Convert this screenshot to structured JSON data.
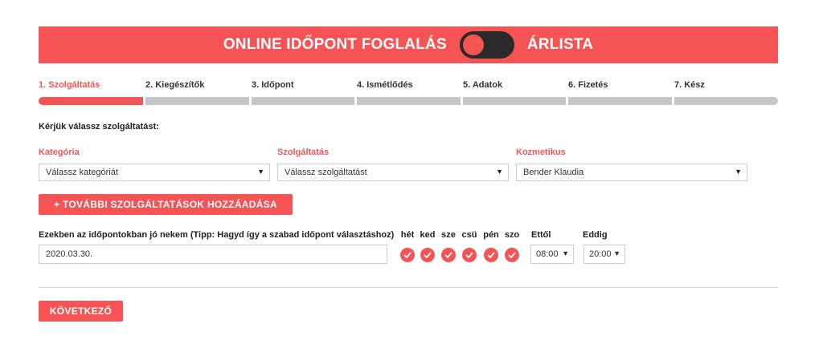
{
  "banner": {
    "left_label": "ONLINE IDŐPONT FOGLALÁS",
    "right_label": "ÁRLISTA",
    "accent": "#f65454"
  },
  "steps": [
    {
      "label": "1. Szolgáltatás",
      "active": true
    },
    {
      "label": "2. Kiegészítők",
      "active": false
    },
    {
      "label": "3. Időpont",
      "active": false
    },
    {
      "label": "4. Ismétlődés",
      "active": false
    },
    {
      "label": "5. Adatok",
      "active": false
    },
    {
      "label": "6. Fizetés",
      "active": false
    },
    {
      "label": "7. Kész",
      "active": false
    }
  ],
  "form": {
    "prompt": "Kérjük válassz szolgáltatást:",
    "category": {
      "label": "Kategória",
      "value": "Válassz kategóriát"
    },
    "service": {
      "label": "Szolgáltatás",
      "value": "Válassz szolgáltatást"
    },
    "staff": {
      "label": "Kozmetikus",
      "value": "Bender Klaudia"
    },
    "add_services_button": "+ TOVÁBBI SZOLGÁLTATÁSOK HOZZÁADÁSA",
    "time_pref_label": "Ezekben az időpontokban jó nekem (Tipp: Hagyd így a szabad időpont választáshoz)",
    "date_value": "2020.03.30.",
    "days": [
      "hét",
      "ked",
      "sze",
      "csü",
      "pén",
      "szo"
    ],
    "from_label": "Ettől",
    "from_value": "08:00",
    "to_label": "Eddig",
    "to_value": "20:00",
    "next_button": "KÖVETKEZŐ"
  },
  "icons": {
    "check": "checkmark-icon",
    "caret": "caret-down-icon"
  }
}
